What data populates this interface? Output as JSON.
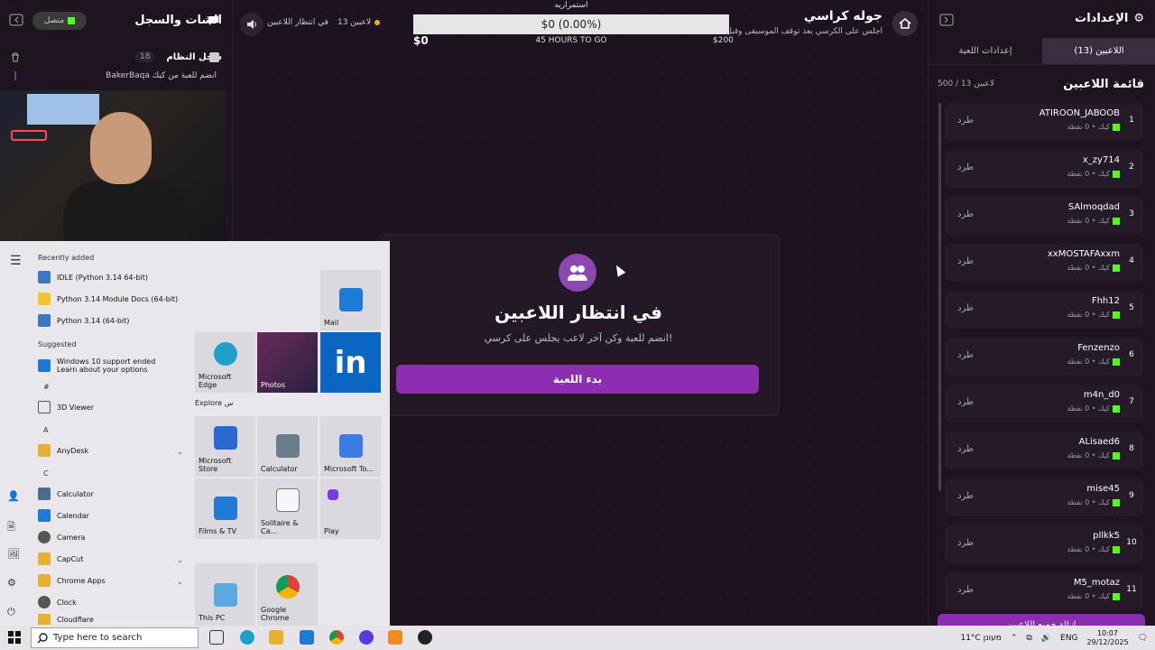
{
  "header": {
    "game_title": "جوله كراسي",
    "game_subtitle": "اجلس على الكرسي بعد توقف الموسيقى وقبل",
    "progress_label": "استمراريه",
    "progress_value": "$0 (0.00%)",
    "progress_left": "$0",
    "progress_mid": "45 HOURS TO GO",
    "progress_right": "$200",
    "players_count": "13 لاعبين",
    "waiting_status": "في انتظار اللاعبين"
  },
  "center": {
    "title": "في انتظار اللاعبين",
    "subtitle": "انضم للعبة وكن آخر لاعب يجلس على كرسي!",
    "start_button": "بدء اللعبة"
  },
  "chat": {
    "title": "الشات والسجل",
    "status": "متصل",
    "system_log": "سجل النظام",
    "log_count": "18",
    "log_message": "BakerBaqa انضم للعبة من كيك"
  },
  "settings": {
    "title": "الإعدادات",
    "tab_players": "اللاعبين (13)",
    "tab_game": "إعدادات اللعبة",
    "list_title": "قائمة اللاعبين",
    "list_count": "500 / 13 لاعبين",
    "kick_label": "طرد",
    "meta_label": "كيك • 0 نقطة",
    "remove_all": "إزالة جميع اللاعبين",
    "players": [
      {
        "num": "1",
        "name": "ATIROON_JABOOB"
      },
      {
        "num": "2",
        "name": "x_zy714"
      },
      {
        "num": "3",
        "name": "SAlmoqdad"
      },
      {
        "num": "4",
        "name": "xxMOSTAFAxxm"
      },
      {
        "num": "5",
        "name": "Fhh12"
      },
      {
        "num": "6",
        "name": "Fenzenzo"
      },
      {
        "num": "7",
        "name": "m4n_d0"
      },
      {
        "num": "8",
        "name": "ALisaed6"
      },
      {
        "num": "9",
        "name": "mise45"
      },
      {
        "num": "10",
        "name": "pllkk5"
      },
      {
        "num": "11",
        "name": "M5_motaz"
      }
    ]
  },
  "start_menu": {
    "recently_added": "Recently added",
    "recent": [
      "IDLE (Python 3.14 64-bit)",
      "Python 3.14 Module Docs (64-bit)",
      "Python 3.14 (64-bit)"
    ],
    "suggested": "Suggested",
    "suggestion_title": "Windows 10 support ended",
    "suggestion_sub": "Learn about your options",
    "hash": "#",
    "app_3d": "3D Viewer",
    "letter_a": "A",
    "app_anydesk": "AnyDesk",
    "letter_c": "C",
    "apps_c": [
      "Calculator",
      "Calendar",
      "Camera",
      "CapCut",
      "Chrome Apps",
      "Clock",
      "Cloudflare"
    ],
    "explore": "Explore س",
    "tiles": {
      "mail": "Mail",
      "edge": "Microsoft Edge",
      "photos": "Photos",
      "store": "Microsoft Store",
      "calculator": "Calculator",
      "todo": "Microsoft To...",
      "films": "Films & TV",
      "solitaire": "Solitaire & Ca...",
      "play": "Play",
      "thispc": "This PC",
      "chrome": "Google Chrome"
    }
  },
  "taskbar": {
    "search_placeholder": "Type here to search",
    "weather": "11°C מעונן",
    "lang": "ENG",
    "time": "10:07",
    "date": "29/12/2025"
  },
  "colors": {
    "accent": "#8b2fb0",
    "background": "#1d1220",
    "kick_green": "#53fc18"
  }
}
